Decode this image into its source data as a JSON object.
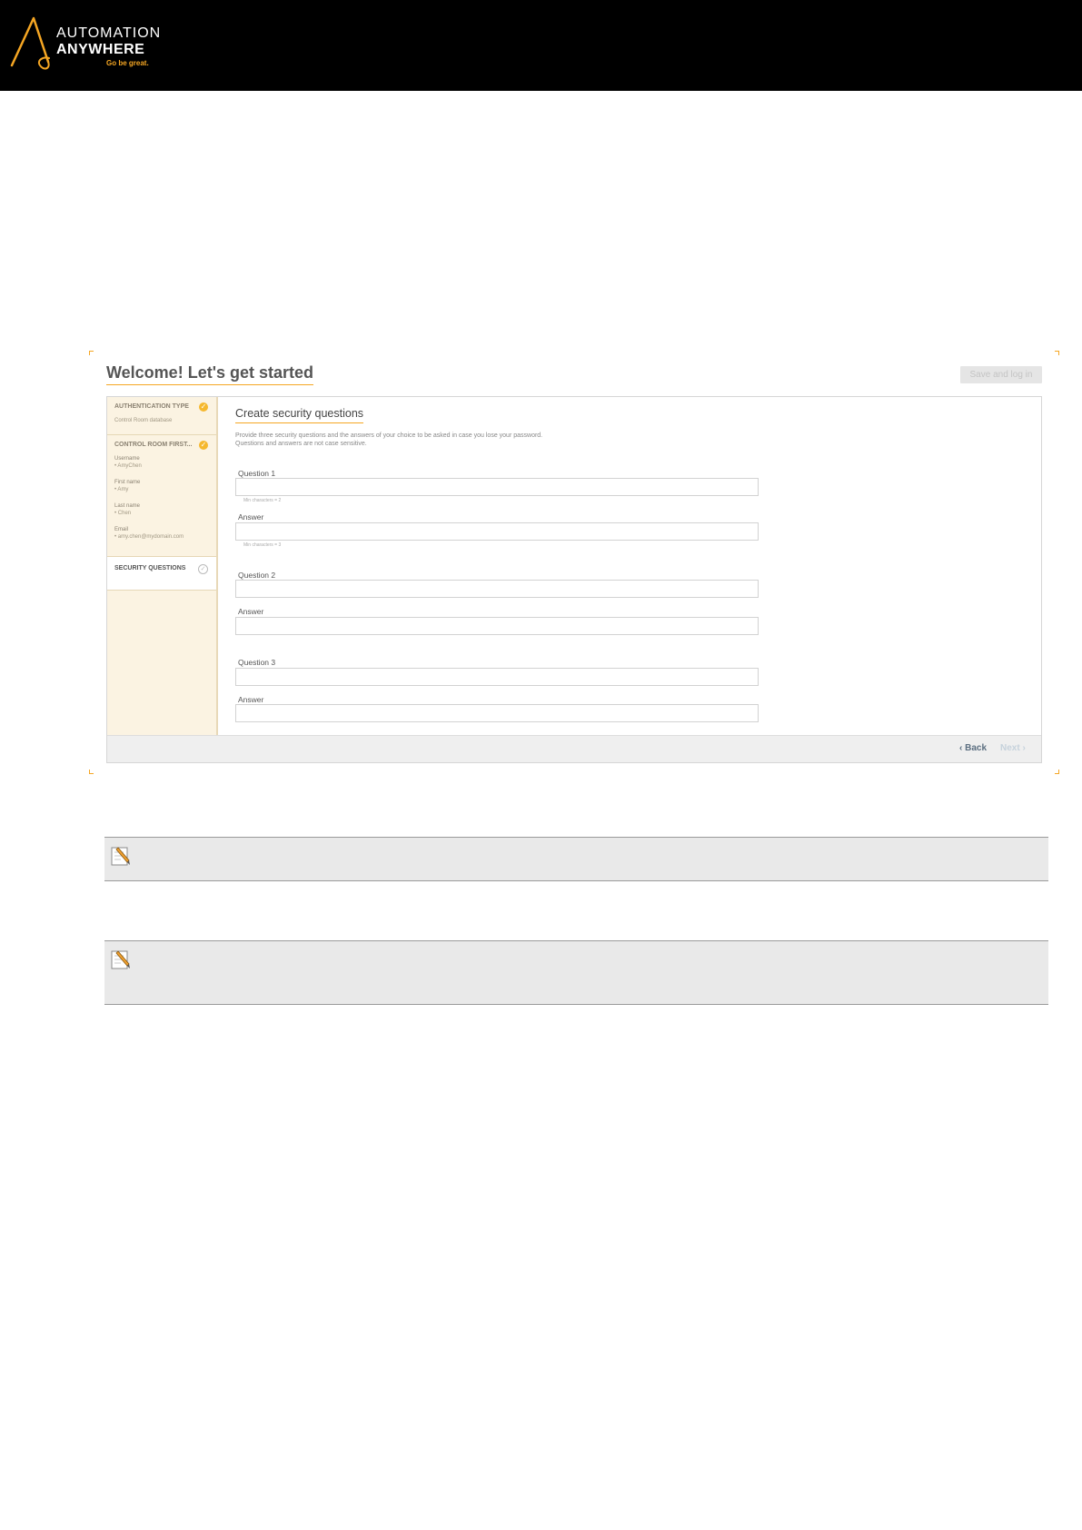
{
  "header": {
    "logo_line1": "AUTOMATION",
    "logo_line2": "ANYWHERE",
    "logo_tagline": "Go be great."
  },
  "page": {
    "title": "Welcome! Let's get started",
    "save_button": "Save and log in"
  },
  "sidebar": {
    "auth": {
      "title": "AUTHENTICATION TYPE",
      "value": "Control Room database"
    },
    "first_user": {
      "title": "CONTROL ROOM FIRST...",
      "fields": [
        {
          "label": "Username",
          "value": "• AmyChen"
        },
        {
          "label": "First name",
          "value": "• Amy"
        },
        {
          "label": "Last name",
          "value": "• Chen"
        },
        {
          "label": "Email",
          "value": "• amy.chen@mydomain.com"
        }
      ]
    },
    "security": {
      "title": "SECURITY QUESTIONS"
    }
  },
  "main": {
    "title": "Create security questions",
    "description": "Provide three security questions and the answers of your choice to be asked in case you lose your password. Questions and answers are not case sensitive.",
    "q1_label": "Question 1",
    "q1_hint": "Min characters = 2",
    "a1_label": "Answer",
    "a1_hint": "Min characters = 3",
    "q2_label": "Question 2",
    "a2_label": "Answer",
    "q3_label": "Question 3",
    "a3_label": "Answer"
  },
  "footer": {
    "back": "‹ Back",
    "next": "Next ›"
  },
  "icons": {
    "note": "note-pencil-icon",
    "check_done": "check-circle-icon",
    "check_pending": "check-circle-outline-icon"
  },
  "colors": {
    "accent": "#f5a623",
    "sidebar_bg": "#fbf3e2",
    "header_bg": "#000000"
  }
}
